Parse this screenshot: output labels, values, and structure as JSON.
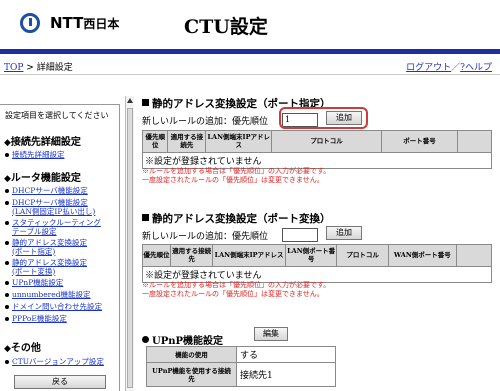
{
  "header": {
    "logo_text": "NTT",
    "logo_suffix": "西日本",
    "title": "CTU設定"
  },
  "breadcrumb": {
    "top": "TOP",
    "sep": " > ",
    "current": "詳細設定"
  },
  "toplinks": {
    "logout": "ログアウト",
    "slash": "／",
    "help": "?ヘルプ"
  },
  "sidebar": {
    "heading": "設定項目を選択してください",
    "group1": "接続先詳細設定",
    "g1_items": [
      "接続先詳細設定"
    ],
    "group2": "ルータ機能設定",
    "g2_items": [
      [
        "DHCPサーバ機能設定"
      ],
      [
        "DHCPサーバ機能設定",
        "(LAN側固定IP払い出し)"
      ],
      [
        "スタティックルーティング",
        "テーブル設定"
      ],
      [
        "静的アドレス変換設定",
        "(ポート指定)"
      ],
      [
        "静的アドレス変換設定",
        "(ポート変換)"
      ],
      [
        "UPnP機能設定"
      ],
      [
        "unnumbered機能設定"
      ],
      [
        "ドメイン問い合わせ先設定"
      ],
      [
        "PPPoE機能設定"
      ]
    ],
    "group3": "その他",
    "g3_items": [
      "CTUバージョンアップ設定"
    ],
    "back_button": "戻る"
  },
  "sections": {
    "port_specify": {
      "title": "静的アドレス変換設定（ポート指定）",
      "add_label": "新しいルールの追加：優先順位",
      "prio_value": "1",
      "add_button": "追加",
      "headers": [
        "優先順位",
        "適用する接続先",
        "LAN側端末IPアドレス",
        "プロトコル",
        "ポート番号"
      ],
      "empty": "※設定が登録されていません",
      "note1": "※ルールを追加する場合は「優先順位」の入力が必要です。",
      "note2": "一度設定されたルールの「優先順位」は変更できません。"
    },
    "port_convert": {
      "title": "静的アドレス変換設定（ポート変換）",
      "add_label": "新しいルールの追加：優先順位",
      "prio_value": "",
      "add_button": "追加",
      "headers": [
        "優先順位",
        "適用する接続先",
        "LAN側端末IPアドレス",
        "LAN側ポート番号",
        "プロトコル",
        "WAN側ポート番号"
      ],
      "empty": "※設定が登録されていません",
      "note1": "※ルールを追加する場合は「優先順位」の入力が必要です。",
      "note2": "一度設定されたルールの「優先順位」は変更できません。"
    },
    "upnp": {
      "title": "UPnP機能設定",
      "edit_button": "編集",
      "rows": [
        {
          "label": "機能の使用",
          "value": "する"
        },
        {
          "label": "UPnP機能を使用する接続先",
          "value": "接続先1"
        }
      ]
    }
  }
}
